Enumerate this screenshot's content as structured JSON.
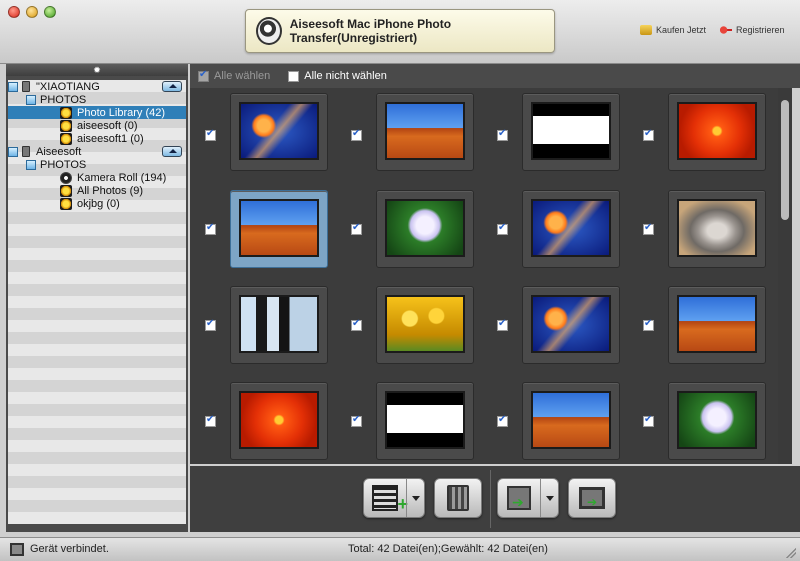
{
  "window": {
    "title": "Aiseesoft Mac iPhone Photo Transfer(Unregistriert)",
    "links": {
      "buy": "Kaufen Jetzt",
      "register": "Registrieren"
    }
  },
  "sidebar": {
    "header_icon": "gear-icon",
    "devices": [
      {
        "name": "\"XIAOTIANG",
        "section": "PHOTOS",
        "albums": [
          "Photo Library (42)",
          "aiseesoft (0)",
          "aiseesoft1 (0)"
        ]
      },
      {
        "name": "Aiseesoft",
        "section": "PHOTOS",
        "albums": [
          "Kamera Roll (194)",
          "All Photos (9)",
          "okjbg (0)"
        ]
      }
    ]
  },
  "selectbar": {
    "select_all": "Alle wählen",
    "select_none": "Alle nicht wählen"
  },
  "toolbar": {
    "buttons": [
      "add-file-button",
      "delete-button",
      "export-to-pc-button",
      "export-to-device-button"
    ]
  },
  "status": {
    "left": "Gerät verbindet.",
    "center": "Total: 42 Datei(en);Gewählt: 42 Datei(en)"
  },
  "colors": {
    "selection": "#2f7fb8",
    "checkmark": "#2b62c8",
    "panel_dark": "#3c3c3c"
  }
}
